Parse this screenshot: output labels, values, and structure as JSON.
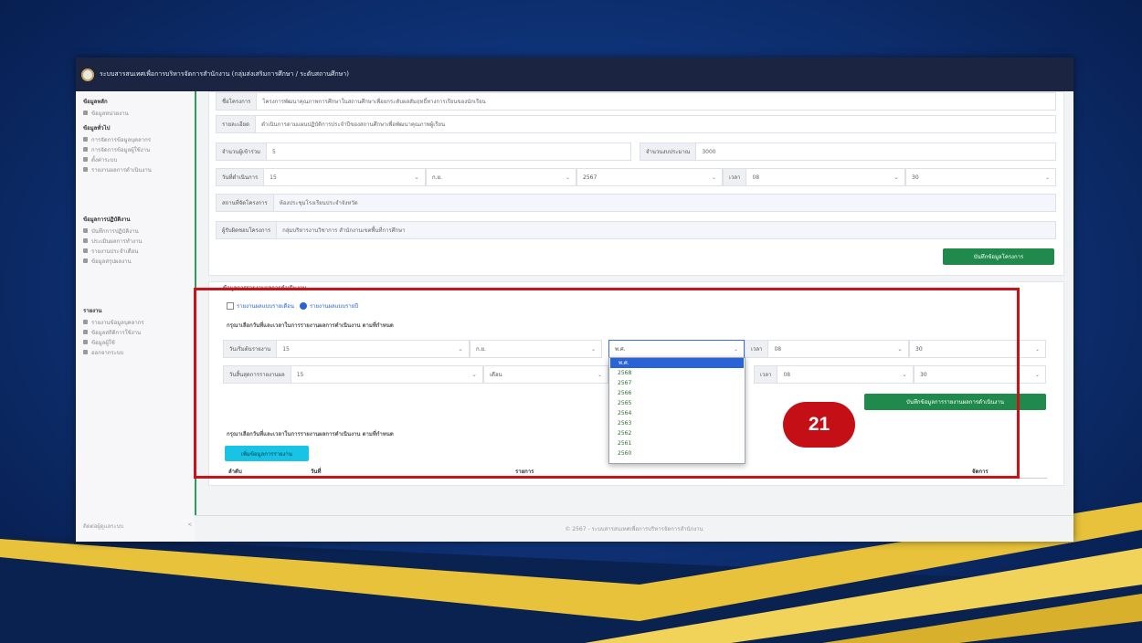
{
  "app": {
    "title": "ระบบสารสนเทศเพื่อการบริหารจัดการสำนักงาน (กลุ่มส่งเสริมการศึกษา / ระดับสถานศึกษา)"
  },
  "sidebar": {
    "sections": [
      {
        "heading": "ข้อมูลหลัก",
        "items": [
          "ข้อมูลหน่วยงาน"
        ]
      },
      {
        "heading": "ข้อมูลทั่วไป",
        "items": [
          "การจัดการข้อมูลบุคลากร",
          "การจัดการข้อมูลผู้ใช้งาน",
          "ตั้งค่าระบบ",
          "รายงานผลการดำเนินงาน"
        ]
      },
      {
        "heading": "ข้อมูลการปฏิบัติงาน",
        "items": [
          "บันทึกการปฏิบัติงาน",
          "ประเมินผลการทำงาน",
          "รายงานประจำเดือน",
          "ข้อมูลสรุปผลงาน"
        ]
      },
      {
        "heading": "รายงาน",
        "items": [
          "รายงานข้อมูลบุคลากร",
          "ข้อมูลสถิติการใช้งาน",
          "ข้อมูลผู้ใช้",
          "ออกจากระบบ"
        ]
      }
    ],
    "footer_left": "ติดต่อผู้ดูแลระบบ",
    "footer_right": "<"
  },
  "form": {
    "row1": {
      "label": "ชื่อโครงการ",
      "value": "โครงการพัฒนาคุณภาพการศึกษาในสถานศึกษาเพื่อยกระดับผลสัมฤทธิ์ทางการเรียนของนักเรียน"
    },
    "row2": {
      "label": "รายละเอียด",
      "value": "ดำเนินการตามแผนปฏิบัติการประจำปีของสถานศึกษาเพื่อพัฒนาคุณภาพผู้เรียน"
    },
    "row3": {
      "label": "จำนวนผู้เข้าร่วม",
      "value": "5",
      "label2": "จำนวนงบประมาณ",
      "value2": "3000"
    },
    "row4": {
      "label": "วันที่ดำเนินการ",
      "day": "15",
      "month": "ก.ย.",
      "year": "2567",
      "time_label": "เวลา",
      "hour": "08",
      "minute": "30"
    },
    "row5": {
      "label": "สถานที่จัดโครงการ",
      "value": "ห้องประชุมโรงเรียนประจำจังหวัด"
    },
    "row6": {
      "label": "ผู้รับผิดชอบโครงการ",
      "value": "กลุ่มบริหารงานวิชาการ สำนักงานเขตพื้นที่การศึกษา"
    },
    "save_button": "บันทึกข้อมูลโครงการ"
  },
  "section2": {
    "heading": "ข้อมูลการรายงานผลการดำเนินงาน",
    "option_a": "รายงานผลแบบรายเดือน",
    "option_b": "รายงานผลแบบรายปี",
    "instruction": "กรุณาเลือกวันที่และเวลาในการรายงานผลการดำเนินงาน ตามที่กำหนด",
    "start": {
      "label": "วันเริ่มต้นรายงาน",
      "day": "15",
      "month": "ก.ย.",
      "year": "พ.ศ.",
      "time_label": "เวลา",
      "hour": "08",
      "minute": "30"
    },
    "end": {
      "label": "วันสิ้นสุดการรายงานผล",
      "day": "15",
      "month": "เดือน",
      "time_label": "เวลา",
      "hour": "08",
      "minute": "30"
    },
    "save_button": "บันทึกข้อมูลการรายงานผลการดำเนินงาน",
    "instruction2": "กรุณาเลือกวันที่และเวลาในการรายงานผลการดำเนินงาน ตามที่กำหนด",
    "add_button": "เพิ่มข้อมูลการรายงาน",
    "table_headers": [
      "ลำดับ",
      "วันที่",
      "รายการ",
      "จัดการ"
    ]
  },
  "year_dropdown": {
    "options": [
      "พ.ศ.",
      "2568",
      "2567",
      "2566",
      "2565",
      "2564",
      "2563",
      "2562",
      "2561",
      "2560"
    ],
    "selected_index": 0
  },
  "footer": {
    "text": "© 2567 - ระบบสารสนเทศเพื่อการบริหารจัดการสำนักงาน"
  },
  "annotation": {
    "step_number": "21"
  },
  "colors": {
    "accent_green": "#1f8a4c",
    "accent_blue": "#2a63d6",
    "annotation_red": "#c8131b",
    "titlebar": "#1b2440"
  }
}
